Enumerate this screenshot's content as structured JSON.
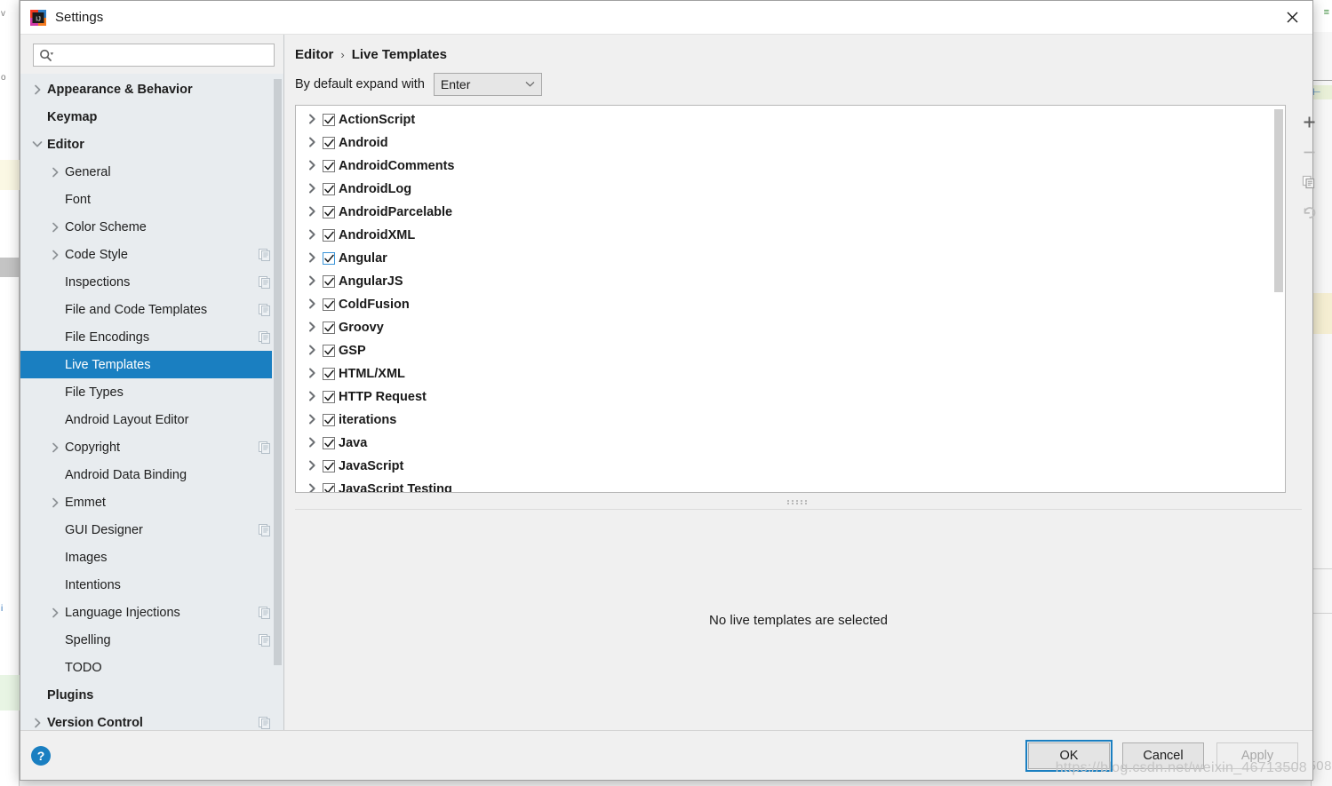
{
  "window": {
    "title": "Settings",
    "app_icon": "intellij-idea-logo",
    "close_icon": "close-icon"
  },
  "search": {
    "value": "",
    "placeholder": "",
    "icon": "search-icon"
  },
  "sidebar": {
    "scrollbar": "sidebar-scrollbar",
    "items": [
      {
        "label": "Appearance & Behavior",
        "arrow": "chevron-right",
        "indent": 0,
        "bold": true,
        "selected": false,
        "badge": false
      },
      {
        "label": "Keymap",
        "arrow": "none",
        "indent": 0,
        "bold": true,
        "selected": false,
        "badge": false
      },
      {
        "label": "Editor",
        "arrow": "chevron-down",
        "indent": 0,
        "bold": true,
        "selected": false,
        "badge": false
      },
      {
        "label": "General",
        "arrow": "chevron-right",
        "indent": 1,
        "bold": false,
        "selected": false,
        "badge": false
      },
      {
        "label": "Font",
        "arrow": "none",
        "indent": 1,
        "bold": false,
        "selected": false,
        "badge": false
      },
      {
        "label": "Color Scheme",
        "arrow": "chevron-right",
        "indent": 1,
        "bold": false,
        "selected": false,
        "badge": false
      },
      {
        "label": "Code Style",
        "arrow": "chevron-right",
        "indent": 1,
        "bold": false,
        "selected": false,
        "badge": true
      },
      {
        "label": "Inspections",
        "arrow": "none",
        "indent": 1,
        "bold": false,
        "selected": false,
        "badge": true
      },
      {
        "label": "File and Code Templates",
        "arrow": "none",
        "indent": 1,
        "bold": false,
        "selected": false,
        "badge": true
      },
      {
        "label": "File Encodings",
        "arrow": "none",
        "indent": 1,
        "bold": false,
        "selected": false,
        "badge": true
      },
      {
        "label": "Live Templates",
        "arrow": "none",
        "indent": 1,
        "bold": false,
        "selected": true,
        "badge": false
      },
      {
        "label": "File Types",
        "arrow": "none",
        "indent": 1,
        "bold": false,
        "selected": false,
        "badge": false
      },
      {
        "label": "Android Layout Editor",
        "arrow": "none",
        "indent": 1,
        "bold": false,
        "selected": false,
        "badge": false
      },
      {
        "label": "Copyright",
        "arrow": "chevron-right",
        "indent": 1,
        "bold": false,
        "selected": false,
        "badge": true
      },
      {
        "label": "Android Data Binding",
        "arrow": "none",
        "indent": 1,
        "bold": false,
        "selected": false,
        "badge": false
      },
      {
        "label": "Emmet",
        "arrow": "chevron-right",
        "indent": 1,
        "bold": false,
        "selected": false,
        "badge": false
      },
      {
        "label": "GUI Designer",
        "arrow": "none",
        "indent": 1,
        "bold": false,
        "selected": false,
        "badge": true
      },
      {
        "label": "Images",
        "arrow": "none",
        "indent": 1,
        "bold": false,
        "selected": false,
        "badge": false
      },
      {
        "label": "Intentions",
        "arrow": "none",
        "indent": 1,
        "bold": false,
        "selected": false,
        "badge": false
      },
      {
        "label": "Language Injections",
        "arrow": "chevron-right",
        "indent": 1,
        "bold": false,
        "selected": false,
        "badge": true
      },
      {
        "label": "Spelling",
        "arrow": "none",
        "indent": 1,
        "bold": false,
        "selected": false,
        "badge": true
      },
      {
        "label": "TODO",
        "arrow": "none",
        "indent": 1,
        "bold": false,
        "selected": false,
        "badge": false
      },
      {
        "label": "Plugins",
        "arrow": "none",
        "indent": 0,
        "bold": true,
        "selected": false,
        "badge": false
      },
      {
        "label": "Version Control",
        "arrow": "chevron-right",
        "indent": 0,
        "bold": true,
        "selected": false,
        "badge": true
      }
    ]
  },
  "main": {
    "breadcrumb": {
      "root": "Editor",
      "separator": "›",
      "leaf": "Live Templates"
    },
    "expand": {
      "label": "By default expand with",
      "selected": "Enter",
      "chevron_icon": "chevron-down-icon"
    },
    "templates": [
      {
        "label": "ActionScript",
        "checked": true,
        "focused": false
      },
      {
        "label": "Android",
        "checked": true,
        "focused": false
      },
      {
        "label": "AndroidComments",
        "checked": true,
        "focused": false
      },
      {
        "label": "AndroidLog",
        "checked": true,
        "focused": false
      },
      {
        "label": "AndroidParcelable",
        "checked": true,
        "focused": false
      },
      {
        "label": "AndroidXML",
        "checked": true,
        "focused": false
      },
      {
        "label": "Angular",
        "checked": true,
        "focused": true
      },
      {
        "label": "AngularJS",
        "checked": true,
        "focused": false
      },
      {
        "label": "ColdFusion",
        "checked": true,
        "focused": false
      },
      {
        "label": "Groovy",
        "checked": true,
        "focused": false
      },
      {
        "label": "GSP",
        "checked": true,
        "focused": false
      },
      {
        "label": "HTML/XML",
        "checked": true,
        "focused": false
      },
      {
        "label": "HTTP Request",
        "checked": true,
        "focused": false
      },
      {
        "label": "iterations",
        "checked": true,
        "focused": false
      },
      {
        "label": "Java",
        "checked": true,
        "focused": false
      },
      {
        "label": "JavaScript",
        "checked": true,
        "focused": false
      },
      {
        "label": "JavaScript Testing",
        "checked": true,
        "focused": false
      }
    ],
    "toolbar": [
      {
        "name": "add-template-button",
        "icon": "plus-icon"
      },
      {
        "name": "remove-template-button",
        "icon": "minus-icon"
      },
      {
        "name": "copy-template-button",
        "icon": "copy-icon"
      },
      {
        "name": "revert-template-button",
        "icon": "revert-icon"
      }
    ],
    "empty_detail_message": "No live templates are selected"
  },
  "footer": {
    "help_label": "?",
    "ok_label": "OK",
    "cancel_label": "Cancel",
    "apply_label": "Apply"
  },
  "watermark": "https://blog.csdn.net/weixin_46713508",
  "background": {
    "left_tab_1": "v",
    "left_tab_2": "o",
    "left_tab_3": "i",
    "right_green": "≡",
    "right_blue": "⊢",
    "watermark_tail": "508"
  },
  "colors": {
    "accent": "#1a7fc1",
    "sidebar_bg": "#e8ecef",
    "dialog_bg": "#f0f0f0",
    "list_bg": "#ffffff",
    "focus_checkbox_border": "#3a94d8"
  }
}
